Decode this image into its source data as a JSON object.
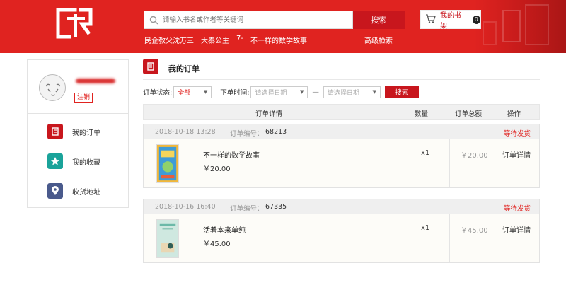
{
  "header": {
    "search_placeholder": "请输入书名或作者等关键词",
    "search_button": "搜索",
    "hot_words": [
      "民企教父沈万三",
      "大秦公主",
      "7-",
      "不一样的数学故事"
    ],
    "advanced_search": "高级检索",
    "cart_label": "我的书架",
    "cart_count": "0",
    "brand_color": "#e02320"
  },
  "sidebar": {
    "logout_label": "注销",
    "items": [
      {
        "label": "我的订单",
        "icon": "order-icon",
        "color": "#c8161d"
      },
      {
        "label": "我的收藏",
        "icon": "star-icon",
        "color": "#1aa39a"
      },
      {
        "label": "收货地址",
        "icon": "location-icon",
        "color": "#4a5a8c"
      }
    ]
  },
  "main": {
    "title": "我的订单",
    "filter": {
      "status_label": "订单状态:",
      "status_value": "全部",
      "time_label": "下单时间:",
      "start_placeholder": "请选择日期",
      "separator": "—",
      "end_placeholder": "请选择日期",
      "search_button": "搜索"
    },
    "columns": {
      "details": "订单详情",
      "quantity": "数量",
      "total": "订单总额",
      "action": "操作"
    },
    "orders": [
      {
        "date": "2018-10-18 13:28",
        "number_label": "订单编号：",
        "number": "68213",
        "status": "等待发货",
        "book_title": "不一样的数学故事",
        "price": "￥20.00",
        "quantity": "x1",
        "total": "￥20.00",
        "action": "订单详情"
      },
      {
        "date": "2018-10-16 16:40",
        "number_label": "订单编号：",
        "number": "67335",
        "status": "等待发货",
        "book_title": "活着本来单纯",
        "price": "￥45.00",
        "quantity": "x1",
        "total": "￥45.00",
        "action": "订单详情"
      }
    ]
  }
}
